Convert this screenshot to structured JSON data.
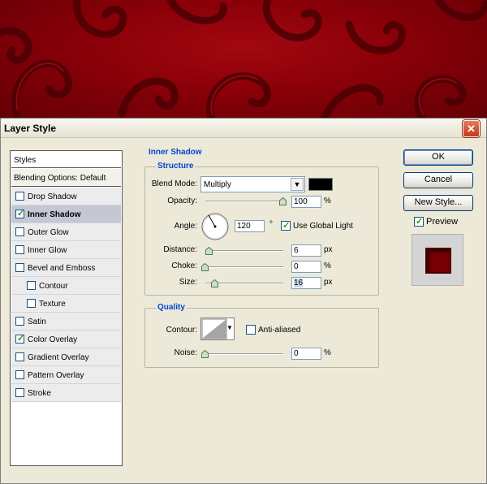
{
  "colors": {
    "accent_blue": "#0046d5",
    "shadow_color": "#000000",
    "preview_color": "#7a0006",
    "background": "#8a0008"
  },
  "dialog": {
    "title": "Layer Style",
    "close_icon": "close-icon"
  },
  "styles_panel": {
    "header": "Styles",
    "blending": "Blending Options: Default",
    "items": [
      {
        "label": "Drop Shadow",
        "checked": false,
        "selected": false,
        "indent": false
      },
      {
        "label": "Inner Shadow",
        "checked": true,
        "selected": true,
        "indent": false
      },
      {
        "label": "Outer Glow",
        "checked": false,
        "selected": false,
        "indent": false
      },
      {
        "label": "Inner Glow",
        "checked": false,
        "selected": false,
        "indent": false
      },
      {
        "label": "Bevel and Emboss",
        "checked": false,
        "selected": false,
        "indent": false
      },
      {
        "label": "Contour",
        "checked": false,
        "selected": false,
        "indent": true
      },
      {
        "label": "Texture",
        "checked": false,
        "selected": false,
        "indent": true
      },
      {
        "label": "Satin",
        "checked": false,
        "selected": false,
        "indent": false
      },
      {
        "label": "Color Overlay",
        "checked": true,
        "selected": false,
        "indent": false
      },
      {
        "label": "Gradient Overlay",
        "checked": false,
        "selected": false,
        "indent": false
      },
      {
        "label": "Pattern Overlay",
        "checked": false,
        "selected": false,
        "indent": false
      },
      {
        "label": "Stroke",
        "checked": false,
        "selected": false,
        "indent": false
      }
    ]
  },
  "inner_shadow": {
    "title": "Inner Shadow",
    "structure": {
      "legend": "Structure",
      "blend_mode_label": "Blend Mode:",
      "blend_mode_value": "Multiply",
      "opacity_label": "Opacity:",
      "opacity_value": "100",
      "opacity_unit": "%",
      "opacity_level": 1.0,
      "angle_label": "Angle:",
      "angle_value": "120",
      "angle_unit": "°",
      "use_global_light_label": "Use Global Light",
      "use_global_light_checked": true,
      "distance_label": "Distance:",
      "distance_value": "6",
      "distance_unit": "px",
      "choke_label": "Choke:",
      "choke_value": "0",
      "choke_unit": "%",
      "size_label": "Size:",
      "size_value": "16",
      "size_unit": "px"
    },
    "quality": {
      "legend": "Quality",
      "contour_label": "Contour:",
      "anti_aliased_label": "Anti-aliased",
      "anti_aliased_checked": false,
      "noise_label": "Noise:",
      "noise_value": "0",
      "noise_unit": "%"
    }
  },
  "buttons": {
    "ok": "OK",
    "cancel": "Cancel",
    "new_style": "New Style...",
    "preview_label": "Preview",
    "preview_checked": true
  }
}
